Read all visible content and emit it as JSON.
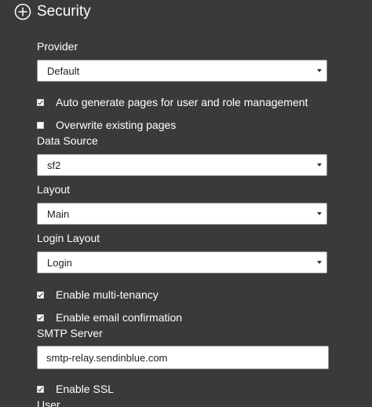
{
  "section": {
    "title": "Security",
    "icon": "plus-circle-icon"
  },
  "provider": {
    "label": "Provider",
    "value": "Default"
  },
  "auto_generate": {
    "label": "Auto generate pages for user and role management",
    "checked": true
  },
  "overwrite": {
    "label": "Overwrite existing pages",
    "checked": false
  },
  "data_source": {
    "label": "Data Source",
    "value": "sf2"
  },
  "layout": {
    "label": "Layout",
    "value": "Main"
  },
  "login_layout": {
    "label": "Login Layout",
    "value": "Login"
  },
  "multi_tenancy": {
    "label": "Enable multi-tenancy",
    "checked": true
  },
  "email_confirmation": {
    "label": "Enable email confirmation",
    "checked": true
  },
  "smtp_server": {
    "label": "SMTP Server",
    "value": "smtp-relay.sendinblue.com"
  },
  "enable_ssl": {
    "label": "Enable SSL",
    "checked": true
  },
  "user": {
    "label": "User"
  },
  "colors": {
    "background": "#3a3a3a",
    "text": "#ffffff",
    "field_background": "#ffffff"
  }
}
